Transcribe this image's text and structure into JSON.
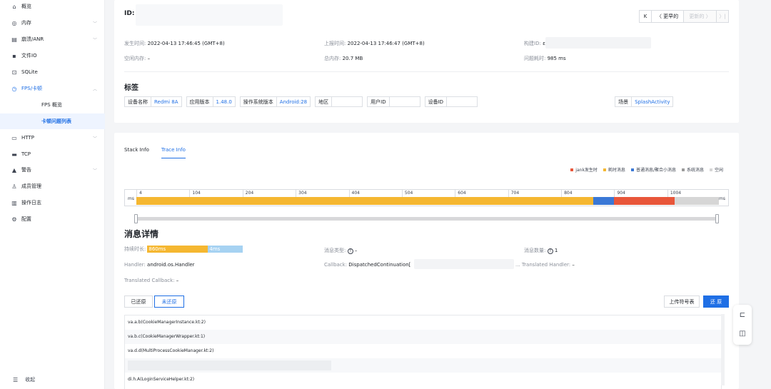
{
  "sidebar": {
    "items": [
      {
        "label": "概览",
        "icon": "home-icon",
        "glyph": "⌂"
      },
      {
        "label": "内存",
        "icon": "memory-icon",
        "glyph": "◎",
        "chevron": "﹀"
      },
      {
        "label": "崩溃/ANR",
        "icon": "crash-icon",
        "glyph": "▤",
        "chevron": "﹀"
      },
      {
        "label": "文件IO",
        "icon": "file-io-icon",
        "glyph": "▪"
      },
      {
        "label": "SQLite",
        "icon": "database-icon",
        "glyph": "⊡"
      },
      {
        "label": "FPS/卡顿",
        "icon": "fps-icon",
        "glyph": "◷",
        "chevron": "︿"
      },
      {
        "label": "FPS 概览"
      },
      {
        "label": "卡顿问题列表"
      },
      {
        "label": "HTTP",
        "icon": "http-icon",
        "glyph": "▭",
        "chevron": "﹀"
      },
      {
        "label": "TCP",
        "icon": "tcp-icon",
        "glyph": "▬"
      },
      {
        "label": "警告",
        "icon": "bell-icon",
        "glyph": "▲",
        "chevron": "﹀"
      },
      {
        "label": "成员管理",
        "icon": "member-icon",
        "glyph": "♙"
      },
      {
        "label": "操作日志",
        "icon": "log-icon",
        "glyph": "▥"
      },
      {
        "label": "配置",
        "icon": "settings-icon",
        "glyph": "⚙"
      }
    ],
    "collapse_label": "收起",
    "collapse_glyph": "☰"
  },
  "header": {
    "id_label": "ID:",
    "nav": {
      "first": "K",
      "prev": "〈 更早的",
      "next": "更新的 〉",
      "last": "〉|"
    }
  },
  "info": {
    "occur_time_k": "发生时间:",
    "occur_time_v": "2022-04-13 17:46:45 (GMT+8)",
    "report_time_k": "上报时间:",
    "report_time_v": "2022-04-13 17:46:47 (GMT+8)",
    "build_id_k": "构建ID:",
    "build_id_v": "ε",
    "free_mem_k": "空闲内存:",
    "free_mem_v": "–",
    "total_mem_k": "总内存:",
    "total_mem_v": "20.7 MB",
    "duration_k": "问题耗时:",
    "duration_v": "985 ms"
  },
  "tags": {
    "title": "标签",
    "items": [
      {
        "k": "设备名称",
        "v": "Redmi 8A"
      },
      {
        "k": "应用版本",
        "v": "1.48.0"
      },
      {
        "k": "操作系统版本",
        "v": "Android:28"
      },
      {
        "k": "地区",
        "v": ""
      },
      {
        "k": "用户ID",
        "v": ""
      },
      {
        "k": "设备ID",
        "v": ""
      },
      {
        "k": "场景",
        "v": "SplashActivity"
      }
    ]
  },
  "tabs": {
    "stack": "Stack Info",
    "trace": "Trace Info"
  },
  "legend": [
    {
      "label": "jank发生时",
      "color": "#e8563a"
    },
    {
      "label": "耗时消息",
      "color": "#f5b731"
    },
    {
      "label": "普通消息/聚合小消息",
      "color": "#3a78d6"
    },
    {
      "label": "系统消息",
      "color": "#9b9b9b"
    },
    {
      "label": "空闲",
      "color": "#d6d6d6"
    }
  ],
  "timeline": {
    "unit": "ms",
    "ticks": [
      "4",
      "104",
      "204",
      "304",
      "404",
      "504",
      "604",
      "704",
      "804",
      "904",
      "1004"
    ],
    "segments_ms": [
      {
        "from": 4,
        "to": 864,
        "color": "#f5b731"
      },
      {
        "from": 864,
        "to": 904,
        "color": "#3a78d6"
      },
      {
        "from": 904,
        "to": 1018,
        "color": "#e8563a"
      },
      {
        "from": 1018,
        "to": 1101,
        "color": "#d6d6d6"
      }
    ]
  },
  "detail": {
    "title": "消息详情",
    "duration_k": "持续时长:",
    "bar1": "860ms",
    "bar2": "4ms",
    "type_k": "消息类型:",
    "type_v": "–",
    "count_k": "消息数量:",
    "count_v": "1",
    "help_glyph": "?",
    "handler_k": "Handler:",
    "handler_v": "android.os.Handler",
    "callback_k": "Callback:",
    "callback_v": "DispatchedContinuation[",
    "trans_handler_k": "... Translated Handler:",
    "trans_handler_v": "–",
    "trans_callback_k": "Translated Callback:",
    "trans_callback_v": "–"
  },
  "buttons": {
    "restored": "已还原",
    "unrestored": "未还原",
    "upload": "上传符号表",
    "restore": "还 原"
  },
  "stack": [
    "va.a.b(CookieManagerInstance.kt:2)",
    "va.b.c(CookieManagerWrapper.kt:1)",
    "va.d.d(MultiProcessCookieManager.kt:2)",
    "",
    "di.h.A(LoginServiceHelper.kt:2)"
  ],
  "float_tools": {
    "top_glyph": "⊏",
    "bottom_glyph": "◫"
  }
}
